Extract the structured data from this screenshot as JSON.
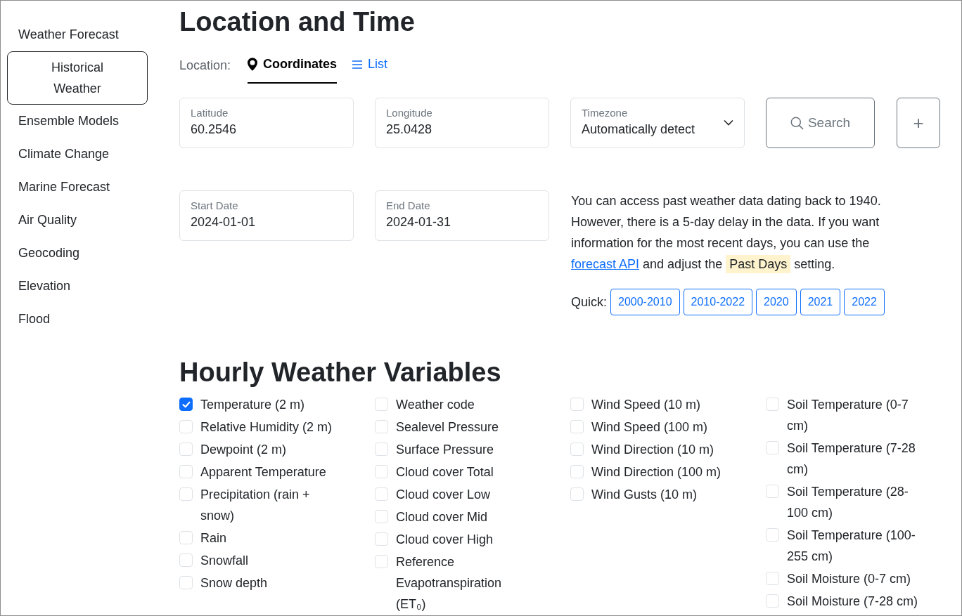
{
  "sidebar": {
    "items": [
      {
        "label": "Weather Forecast",
        "selected": false
      },
      {
        "label": "Historical Weather",
        "selected": true
      },
      {
        "label": "Ensemble Models",
        "selected": false
      },
      {
        "label": "Climate Change",
        "selected": false
      },
      {
        "label": "Marine Forecast",
        "selected": false
      },
      {
        "label": "Air Quality",
        "selected": false
      },
      {
        "label": "Geocoding",
        "selected": false
      },
      {
        "label": "Elevation",
        "selected": false
      },
      {
        "label": "Flood",
        "selected": false
      }
    ]
  },
  "location_section": {
    "title": "Location and Time",
    "location_label": "Location:",
    "tabs": [
      {
        "label": "Coordinates",
        "selected": true
      },
      {
        "label": "List",
        "selected": false
      }
    ],
    "fields": [
      {
        "kind": "text",
        "label": "Latitude",
        "value": "60.2546"
      },
      {
        "kind": "text",
        "label": "Longitude",
        "value": "25.0428"
      },
      {
        "kind": "select",
        "label": "Timezone",
        "value": "Automatically detect"
      }
    ],
    "search_button": "Search",
    "add_button": "+",
    "date_fields": [
      {
        "kind": "text",
        "label": "Start Date",
        "value": "2024-01-01"
      },
      {
        "kind": "text",
        "label": "End Date",
        "value": "2024-01-31"
      }
    ],
    "info": {
      "text": "You can access past weather data dating back to 1940. However, there is a 5-day delay in the data. If you want information for the most recent days, you can use the",
      "link": "forecast API",
      "text_2": "and adjust the",
      "highlight": "Past Days",
      "text_3": "setting."
    },
    "quick": {
      "label": "Quick:",
      "buttons": [
        "2000-2010",
        "2010-2022",
        "2020",
        "2021",
        "2022"
      ]
    }
  },
  "hourly_section": {
    "title": "Hourly Weather Variables",
    "columns": [
      [
        {
          "label": "Temperature (2 m)",
          "checked": true
        },
        {
          "label": "Relative Humidity (2 m)",
          "checked": false
        },
        {
          "label": "Dewpoint (2 m)",
          "checked": false
        },
        {
          "label": "Apparent Temperature",
          "checked": false
        },
        {
          "label": "Precipitation (rain + snow)",
          "checked": false
        },
        {
          "label": "Rain",
          "checked": false
        },
        {
          "label": "Snowfall",
          "checked": false
        },
        {
          "label": "Snow depth",
          "checked": false
        }
      ],
      [
        {
          "label": "Weather code",
          "checked": false
        },
        {
          "label": "Sealevel Pressure",
          "checked": false
        },
        {
          "label": "Surface Pressure",
          "checked": false
        },
        {
          "label": "Cloud cover Total",
          "checked": false
        },
        {
          "label": "Cloud cover Low",
          "checked": false
        },
        {
          "label": "Cloud cover Mid",
          "checked": false
        },
        {
          "label": "Cloud cover High",
          "checked": false
        },
        {
          "label": "Reference Evapotranspiration (ET₀)",
          "checked": false
        }
      ],
      [
        {
          "label": "Wind Speed (10 m)",
          "checked": false
        },
        {
          "label": "Wind Speed (100 m)",
          "checked": false
        },
        {
          "label": "Wind Direction (10 m)",
          "checked": false
        },
        {
          "label": "Wind Direction (100 m)",
          "checked": false
        },
        {
          "label": "Wind Gusts (10 m)",
          "checked": false
        }
      ],
      [
        {
          "label": "Soil Temperature (0-7 cm)",
          "checked": false
        },
        {
          "label": "Soil Temperature (7-28 cm)",
          "checked": false
        },
        {
          "label": "Soil Temperature (28-100 cm)",
          "checked": false
        },
        {
          "label": "Soil Temperature (100-255 cm)",
          "checked": false
        },
        {
          "label": "Soil Moisture (0-7 cm)",
          "checked": false
        },
        {
          "label": "Soil Moisture (7-28 cm)",
          "checked": false
        }
      ]
    ]
  }
}
